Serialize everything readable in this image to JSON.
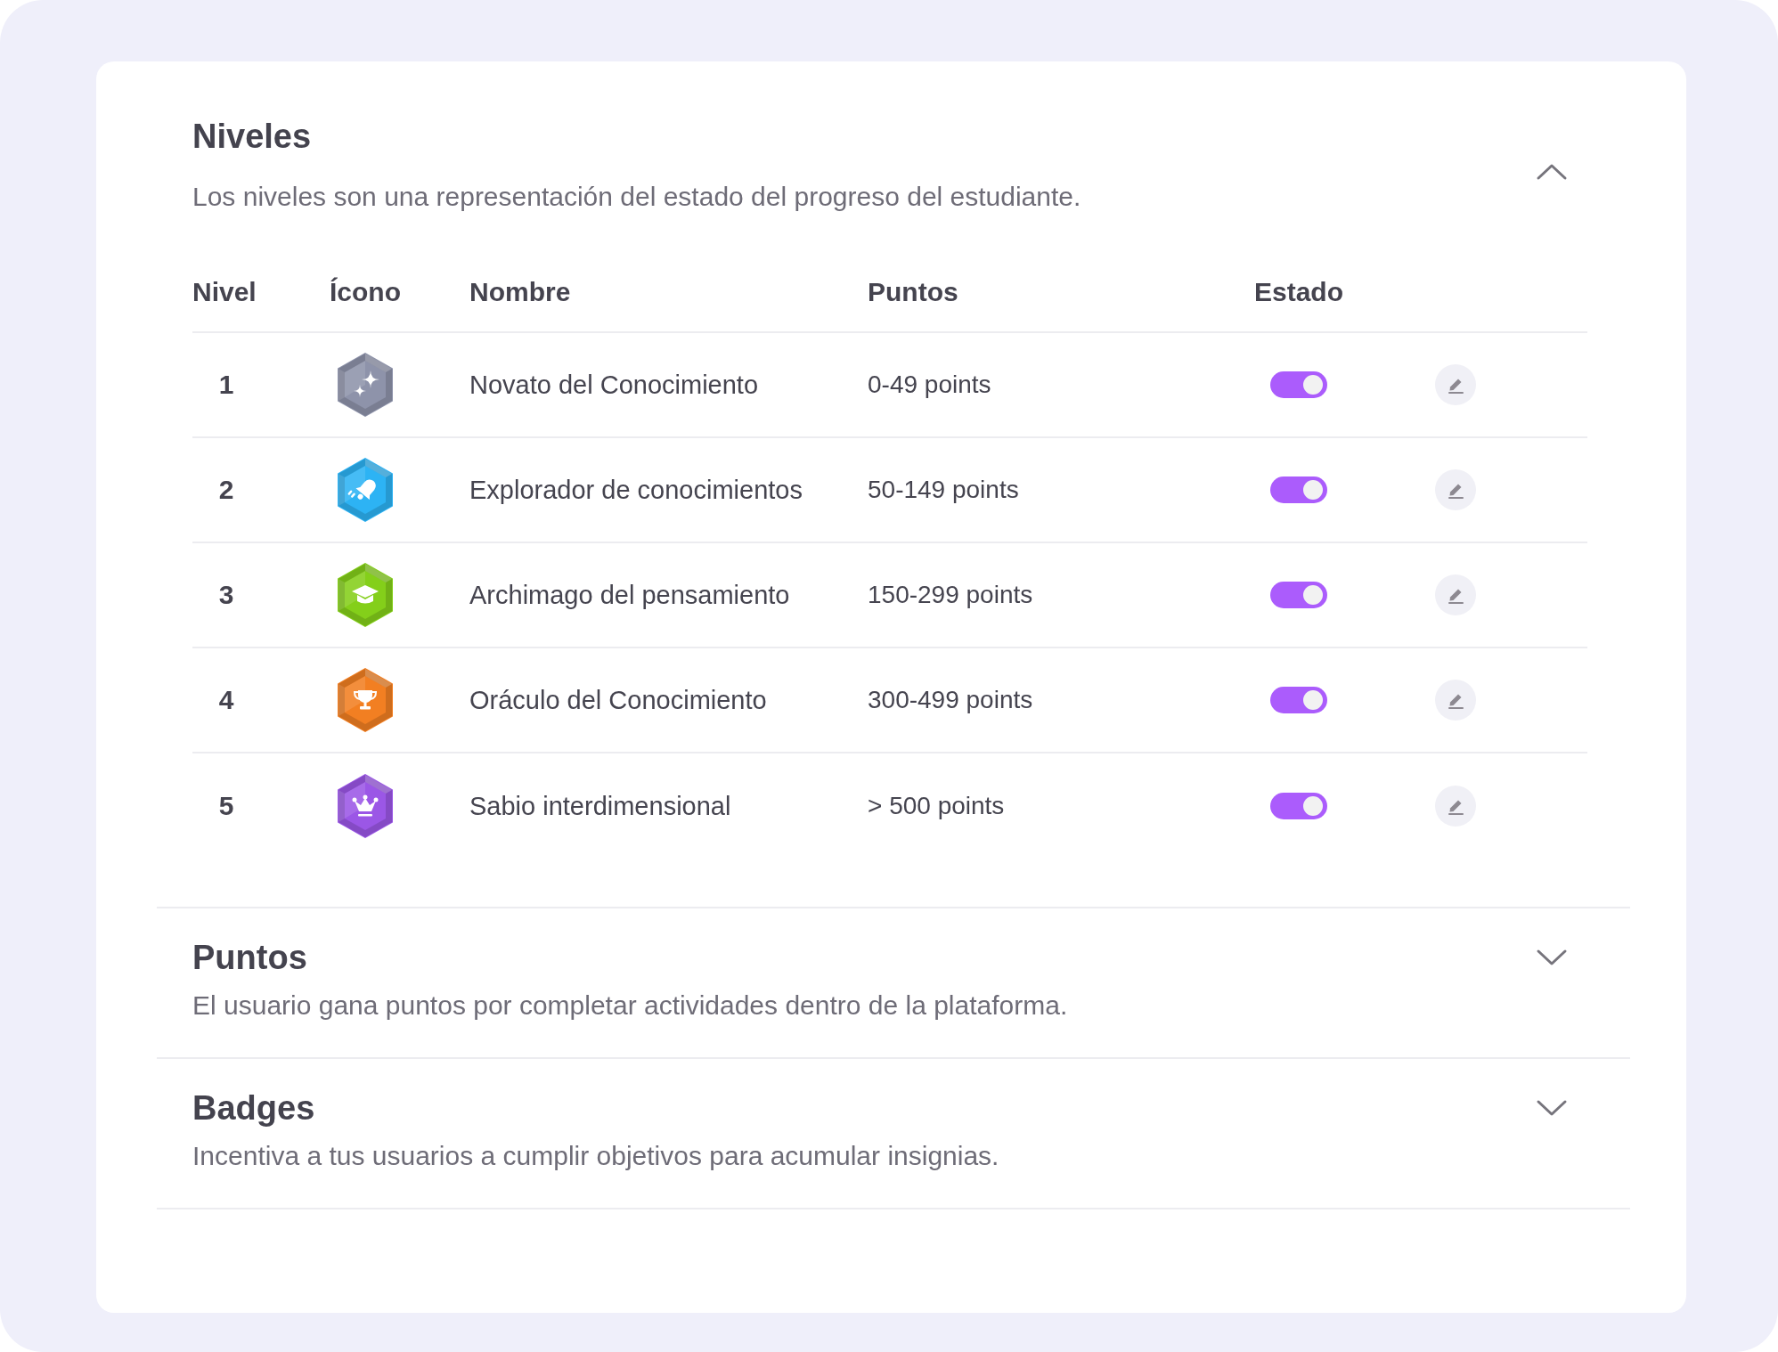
{
  "sections": [
    {
      "title": "Niveles",
      "description": "Los niveles son una representación del estado del progreso del estudiante.",
      "expanded": true,
      "table": {
        "columns": [
          "Nivel",
          "Ícono",
          "Nombre",
          "Puntos",
          "Estado"
        ],
        "rows": [
          {
            "number": "1",
            "kind": "sparkles",
            "color": "#8e93aa",
            "name": "Novato del Conocimiento",
            "points": "0-49 points",
            "on": true
          },
          {
            "number": "2",
            "kind": "bell",
            "color": "#2db3f4",
            "name": "Explorador de conocimientos",
            "points": "50-149 points",
            "on": true
          },
          {
            "number": "3",
            "kind": "cap",
            "color": "#84cf1a",
            "name": "Archimago del pensamiento",
            "points": "150-299 points",
            "on": true
          },
          {
            "number": "4",
            "kind": "trophy",
            "color": "#f27f22",
            "name": "Oráculo del Conocimiento",
            "points": "300-499 points",
            "on": true
          },
          {
            "number": "5",
            "kind": "crown",
            "color": "#9b57e6",
            "name": "Sabio interdimensional",
            "points": "> 500 points",
            "on": true
          }
        ]
      }
    },
    {
      "title": "Puntos",
      "description": "El usuario gana puntos por completar actividades dentro de la plataforma.",
      "expanded": false
    },
    {
      "title": "Badges",
      "description": "Incentiva a tus usuarios a cumplir objetivos para acumular insignias.",
      "expanded": false
    }
  ]
}
